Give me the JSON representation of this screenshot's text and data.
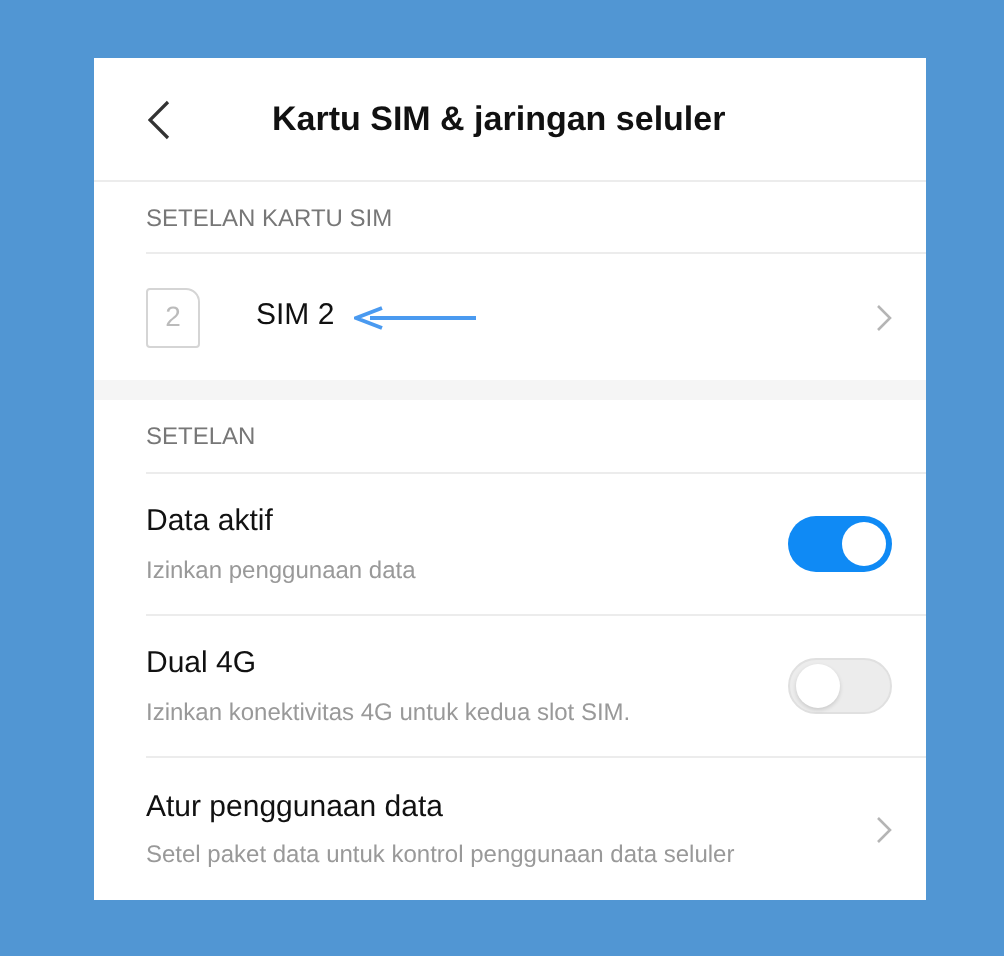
{
  "header": {
    "title": "Kartu SIM & jaringan seluler"
  },
  "sim_section": {
    "heading": "SETELAN KARTU SIM",
    "items": [
      {
        "slot": "2",
        "label": "SIM 2",
        "annotated": true
      }
    ]
  },
  "settings_section": {
    "heading": "SETELAN",
    "items": [
      {
        "kind": "toggle",
        "title": "Data aktif",
        "subtitle": "Izinkan penggunaan data",
        "on": true
      },
      {
        "kind": "toggle",
        "title": "Dual 4G",
        "subtitle": "Izinkan konektivitas 4G untuk kedua slot SIM.",
        "on": false
      },
      {
        "kind": "link",
        "title": "Atur penggunaan data",
        "subtitle": "Setel paket data untuk kontrol penggunaan data seluler"
      }
    ]
  }
}
